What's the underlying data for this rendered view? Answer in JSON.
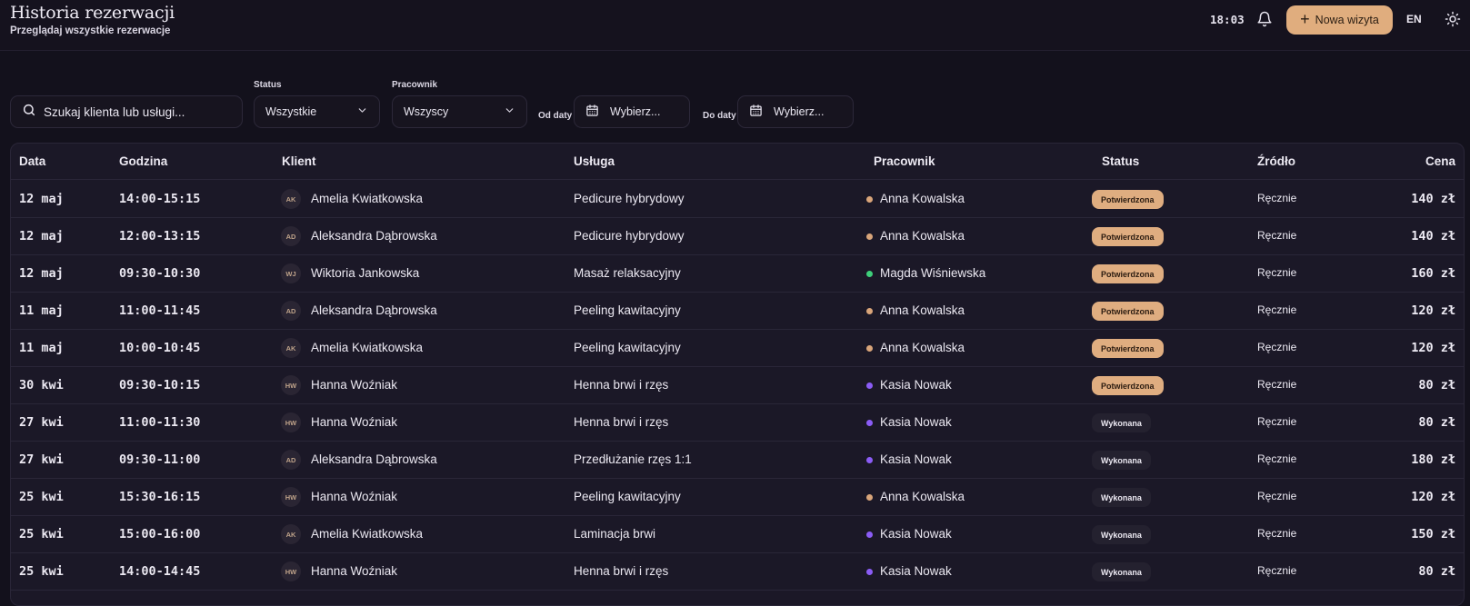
{
  "header": {
    "title": "Historia rezerwacji",
    "subtitle": "Przeglądaj wszystkie rezerwacje",
    "clock": "18:03",
    "new_visit_label": "Nowa wizyta",
    "language": "EN"
  },
  "filters": {
    "search_placeholder": "Szukaj klienta lub usługi...",
    "status_label": "Status",
    "status_value": "Wszystkie",
    "employee_label": "Pracownik",
    "employee_value": "Wszyscy",
    "from_label": "Od daty",
    "from_value": "Wybierz...",
    "to_label": "Do daty",
    "to_value": "Wybierz..."
  },
  "colors": {
    "accent": "#e0ad7e",
    "employee_anna": "#d9a57a",
    "employee_magda": "#3ecf7a",
    "employee_kasia": "#8b5cf6"
  },
  "table": {
    "columns": {
      "date": "Data",
      "time": "Godzina",
      "client": "Klient",
      "service": "Usługa",
      "employee": "Pracownik",
      "status": "Status",
      "source": "Źródło",
      "price": "Cena"
    },
    "rows": [
      {
        "date": "12 maj",
        "time": "14:00-15:15",
        "initials": "AK",
        "client": "Amelia Kwiatkowska",
        "service": "Pedicure hybrydowy",
        "employee": "Anna Kowalska",
        "employee_color": "#d9a57a",
        "status": "Potwierdzona",
        "status_type": "confirmed",
        "source": "Ręcznie",
        "price": "140 zł"
      },
      {
        "date": "12 maj",
        "time": "12:00-13:15",
        "initials": "AD",
        "client": "Aleksandra Dąbrowska",
        "service": "Pedicure hybrydowy",
        "employee": "Anna Kowalska",
        "employee_color": "#d9a57a",
        "status": "Potwierdzona",
        "status_type": "confirmed",
        "source": "Ręcznie",
        "price": "140 zł"
      },
      {
        "date": "12 maj",
        "time": "09:30-10:30",
        "initials": "WJ",
        "client": "Wiktoria Jankowska",
        "service": "Masaż relaksacyjny",
        "employee": "Magda Wiśniewska",
        "employee_color": "#3ecf7a",
        "status": "Potwierdzona",
        "status_type": "confirmed",
        "source": "Ręcznie",
        "price": "160 zł"
      },
      {
        "date": "11 maj",
        "time": "11:00-11:45",
        "initials": "AD",
        "client": "Aleksandra Dąbrowska",
        "service": "Peeling kawitacyjny",
        "employee": "Anna Kowalska",
        "employee_color": "#d9a57a",
        "status": "Potwierdzona",
        "status_type": "confirmed",
        "source": "Ręcznie",
        "price": "120 zł"
      },
      {
        "date": "11 maj",
        "time": "10:00-10:45",
        "initials": "AK",
        "client": "Amelia Kwiatkowska",
        "service": "Peeling kawitacyjny",
        "employee": "Anna Kowalska",
        "employee_color": "#d9a57a",
        "status": "Potwierdzona",
        "status_type": "confirmed",
        "source": "Ręcznie",
        "price": "120 zł"
      },
      {
        "date": "30 kwi",
        "time": "09:30-10:15",
        "initials": "HW",
        "client": "Hanna Woźniak",
        "service": "Henna brwi i rzęs",
        "employee": "Kasia Nowak",
        "employee_color": "#8b5cf6",
        "status": "Potwierdzona",
        "status_type": "confirmed",
        "source": "Ręcznie",
        "price": "80 zł"
      },
      {
        "date": "27 kwi",
        "time": "11:00-11:30",
        "initials": "HW",
        "client": "Hanna Woźniak",
        "service": "Henna brwi i rzęs",
        "employee": "Kasia Nowak",
        "employee_color": "#8b5cf6",
        "status": "Wykonana",
        "status_type": "done",
        "source": "Ręcznie",
        "price": "80 zł"
      },
      {
        "date": "27 kwi",
        "time": "09:30-11:00",
        "initials": "AD",
        "client": "Aleksandra Dąbrowska",
        "service": "Przedłużanie rzęs 1:1",
        "employee": "Kasia Nowak",
        "employee_color": "#8b5cf6",
        "status": "Wykonana",
        "status_type": "done",
        "source": "Ręcznie",
        "price": "180 zł"
      },
      {
        "date": "25 kwi",
        "time": "15:30-16:15",
        "initials": "HW",
        "client": "Hanna Woźniak",
        "service": "Peeling kawitacyjny",
        "employee": "Anna Kowalska",
        "employee_color": "#d9a57a",
        "status": "Wykonana",
        "status_type": "done",
        "source": "Ręcznie",
        "price": "120 zł"
      },
      {
        "date": "25 kwi",
        "time": "15:00-16:00",
        "initials": "AK",
        "client": "Amelia Kwiatkowska",
        "service": "Laminacja brwi",
        "employee": "Kasia Nowak",
        "employee_color": "#8b5cf6",
        "status": "Wykonana",
        "status_type": "done",
        "source": "Ręcznie",
        "price": "150 zł"
      },
      {
        "date": "25 kwi",
        "time": "14:00-14:45",
        "initials": "HW",
        "client": "Hanna Woźniak",
        "service": "Henna brwi i rzęs",
        "employee": "Kasia Nowak",
        "employee_color": "#8b5cf6",
        "status": "Wykonana",
        "status_type": "done",
        "source": "Ręcznie",
        "price": "80 zł"
      }
    ]
  }
}
